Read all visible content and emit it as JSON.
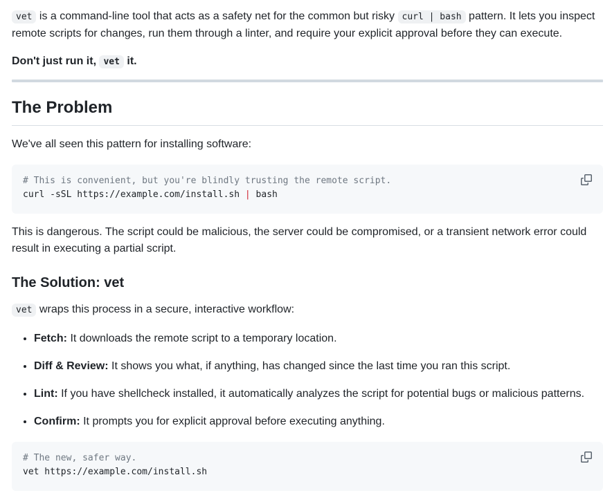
{
  "intro": {
    "code1": "vet",
    "text1": " is a command-line tool that acts as a safety net for the common but risky ",
    "code2": "curl | bash",
    "text2": " pattern. It lets you inspect remote scripts for changes, run them through a linter, and require your explicit approval before they can execute."
  },
  "tagline": {
    "text1": "Don't just run it, ",
    "code": "vet",
    "text2": " it."
  },
  "problem": {
    "heading": "The Problem",
    "lead": "We've all seen this pattern for installing software:",
    "code": {
      "comment": "# This is convenient, but you're blindly trusting the remote script.",
      "cmd_pre": "curl -sSL https://example.com/install.sh ",
      "pipe": "|",
      "cmd_post": " bash"
    },
    "explanation": "This is dangerous. The script could be malicious, the server could be compromised, or a transient network error could result in executing a partial script."
  },
  "solution": {
    "heading": "The Solution: vet",
    "lead_code": "vet",
    "lead_text": " wraps this process in a secure, interactive workflow:",
    "items": [
      {
        "label": "Fetch:",
        "text": " It downloads the remote script to a temporary location."
      },
      {
        "label": "Diff & Review:",
        "text": " It shows you what, if anything, has changed since the last time you ran this script."
      },
      {
        "label": "Lint:",
        "text": " If you have shellcheck installed, it automatically analyzes the script for potential bugs or malicious patterns."
      },
      {
        "label": "Confirm:",
        "text": " It prompts you for explicit approval before executing anything."
      }
    ],
    "code": {
      "comment": "# The new, safer way.",
      "cmd": "vet https://example.com/install.sh"
    }
  },
  "icons": {
    "copy": "copy-icon"
  }
}
